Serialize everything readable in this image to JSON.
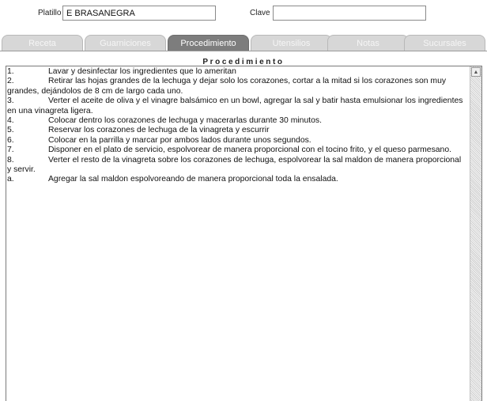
{
  "header": {
    "platillo_label": "Platillo",
    "platillo_value": "E BRASANEGRA",
    "clave_label": "Clave",
    "clave_value": ""
  },
  "tabs": [
    {
      "label": "Receta"
    },
    {
      "label": "Guarniciones"
    },
    {
      "label": "Procedimiento"
    },
    {
      "label": "Utensilios"
    },
    {
      "label": "Notas"
    },
    {
      "label": "Sucursales"
    }
  ],
  "active_tab": "Procedimiento",
  "section_title": "Procedimiento",
  "steps": [
    {
      "num": "1.",
      "text": "Lavar y desinfectar los ingredientes que lo ameritan"
    },
    {
      "num": "2.",
      "text": "Retirar las hojas grandes de la lechuga y dejar solo los corazones, cortar a la mitad si los corazones son muy grandes, dejándolos de 8 cm de largo cada uno."
    },
    {
      "num": "3.",
      "text": "Verter el aceite de oliva y el vinagre balsámico en un bowl, agregar la sal y batir hasta emulsionar los ingredientes en una vinagreta ligera."
    },
    {
      "num": "4.",
      "text": "Colocar dentro los corazones de lechuga y macerarlas durante 30 minutos."
    },
    {
      "num": "5.",
      "text": "Reservar los corazones de lechuga de la vinagreta y escurrir"
    },
    {
      "num": "6.",
      "text": "Colocar en la parrilla y marcar por ambos lados durante unos segundos."
    },
    {
      "num": "7.",
      "text": "Disponer en el plato de servicio, espolvorear de manera proporcional con el tocino frito, y el queso parmesano."
    },
    {
      "num": "8.",
      "text": "Verter el resto de la vinagreta sobre los corazones de lechuga, espolvorear la sal maldon de manera proporcional y servir."
    },
    {
      "num": "a.",
      "text": "Agregar la sal maldon espolvoreando de manera proporcional toda la ensalada."
    }
  ],
  "colors": {
    "tab_active": "#7d7d7d",
    "tab_inactive": "#d7d7d7"
  },
  "icons": {
    "scroll_up": "triangle-up-icon"
  }
}
